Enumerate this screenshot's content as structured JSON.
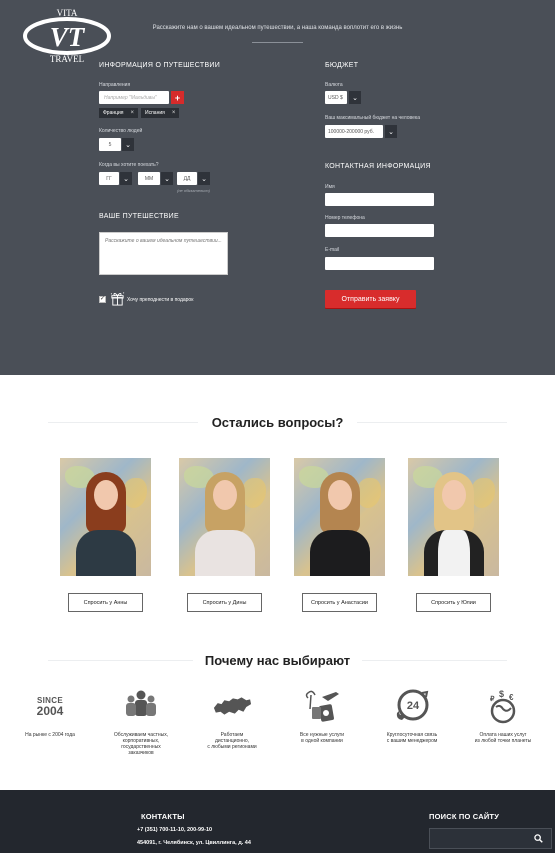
{
  "form": {
    "intro": "Расскажите нам о вашем идеальном путешествии, а наша команда воплотит его в жизнь",
    "travel_info_heading": "ИНФОРМАЦИЯ О ПУТЕШЕСТВИИ",
    "directions_label": "Направления",
    "directions_placeholder": "Например \"Мальдивы\"",
    "add_symbol": "+",
    "tags": [
      "Франция",
      "Испания"
    ],
    "tag_remove": "×",
    "people_label": "Количество людей",
    "people_value": "5",
    "when_label": "Когда вы хотите поехать?",
    "date_year": "ГГ",
    "date_month": "ММ",
    "date_day": "ДД",
    "date_hint": "(не обязательно)",
    "your_trip_heading": "ВАШЕ ПУТЕШЕСТВИЕ",
    "story_placeholder": "Расскажите о вашем идеальном путешествии...",
    "gift_label": "Хочу преподнести в подарок",
    "gift_checked": true,
    "budget_heading": "БЮДЖЕТ",
    "currency_label": "Валюта",
    "currency_value": "USD $",
    "max_budget_label": "Ваш максимальный бюджет на человека",
    "max_budget_value": "100000-200000 руб.",
    "contact_heading": "КОНТАКТНАЯ ИНФОРМАЦИЯ",
    "name_label": "Имя",
    "phone_label": "Номер телефона",
    "email_label": "E-mail",
    "submit_label": "Отправить заявку"
  },
  "questions": {
    "title": "Остались вопросы?",
    "consultants": [
      {
        "button": "Спросить у Анны"
      },
      {
        "button": "Спросить у Дины"
      },
      {
        "button": "Спросить у Анастасии"
      },
      {
        "button": "Спросить у Юлии"
      }
    ]
  },
  "why": {
    "title": "Почему нас выбирают",
    "since_top": "SINCE",
    "since_year": "2004",
    "features": [
      {
        "icon": "since-badge-icon",
        "text": "На рынке с 2004 года"
      },
      {
        "icon": "people-icon",
        "text": "Обслуживаем частных,\nкорпоративных,\nгосударственных\nзаказчиков"
      },
      {
        "icon": "russia-map-icon",
        "text": "Работаем\nдистанционно,\nс любыми регионами"
      },
      {
        "icon": "travel-services-icon",
        "text": "Все нужные услуги\nв одной компании"
      },
      {
        "icon": "phone-24-icon",
        "text": "Круглосуточная связь\nс вашим менеджером"
      },
      {
        "icon": "payment-globe-icon",
        "text": "Оплата наших услуг\nиз любой точки планеты"
      }
    ]
  },
  "footer": {
    "logo_top": "VITA",
    "logo_bottom": "TRAVEL",
    "contacts_heading": "КОНТАКТЫ",
    "phone": "+7 (351) 700-11-10, 200-99-10",
    "address": "454091, г. Челябинск, ул. Цвиллинга, д. 44",
    "search_heading": "ПОИСК ПО САЙТУ"
  },
  "colors": {
    "form_bg": "#4a4f57",
    "accent": "#d82c2c",
    "footer_bg": "#23272e"
  }
}
